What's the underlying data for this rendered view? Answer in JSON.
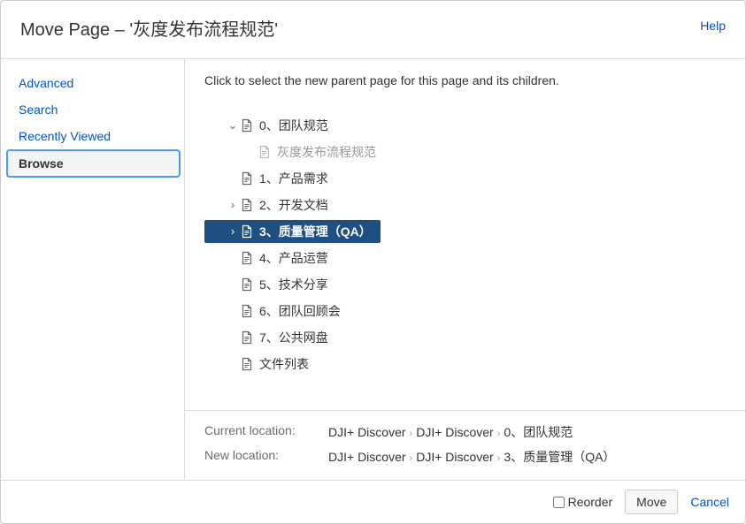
{
  "header": {
    "title": "Move Page – '灰度发布流程规范'",
    "help": "Help"
  },
  "sidebar": {
    "items": [
      {
        "label": "Advanced",
        "active": false
      },
      {
        "label": "Search",
        "active": false
      },
      {
        "label": "Recently Viewed",
        "active": false
      },
      {
        "label": "Browse",
        "active": true
      }
    ]
  },
  "main": {
    "instruction": "Click to select the new parent page for this page and its children.",
    "tree": {
      "cutoff_label": "DJI+ Discover",
      "nodes": [
        {
          "label": "0、团队规范",
          "indent": 1,
          "expand": "open",
          "disabled": false,
          "selected": false
        },
        {
          "label": "灰度发布流程规范",
          "indent": 2,
          "expand": "none",
          "disabled": true,
          "selected": false
        },
        {
          "label": "1、产品需求",
          "indent": 1,
          "expand": "none",
          "disabled": false,
          "selected": false
        },
        {
          "label": "2、开发文档",
          "indent": 1,
          "expand": "closed",
          "disabled": false,
          "selected": false
        },
        {
          "label": "3、质量管理（QA）",
          "indent": 1,
          "expand": "closed",
          "disabled": false,
          "selected": true
        },
        {
          "label": "4、产品运营",
          "indent": 1,
          "expand": "none",
          "disabled": false,
          "selected": false
        },
        {
          "label": "5、技术分享",
          "indent": 1,
          "expand": "none",
          "disabled": false,
          "selected": false
        },
        {
          "label": "6、团队回顾会",
          "indent": 1,
          "expand": "none",
          "disabled": false,
          "selected": false
        },
        {
          "label": "7、公共网盘",
          "indent": 1,
          "expand": "none",
          "disabled": false,
          "selected": false
        },
        {
          "label": "文件列表",
          "indent": 1,
          "expand": "none",
          "disabled": false,
          "selected": false
        }
      ]
    },
    "locations": {
      "current_label": "Current location:",
      "current_path": [
        "DJI+ Discover",
        "DJI+ Discover",
        "0、团队规范"
      ],
      "new_label": "New location:",
      "new_path": [
        "DJI+ Discover",
        "DJI+ Discover",
        "3、质量管理（QA）"
      ]
    }
  },
  "footer": {
    "reorder": "Reorder",
    "move": "Move",
    "cancel": "Cancel"
  }
}
